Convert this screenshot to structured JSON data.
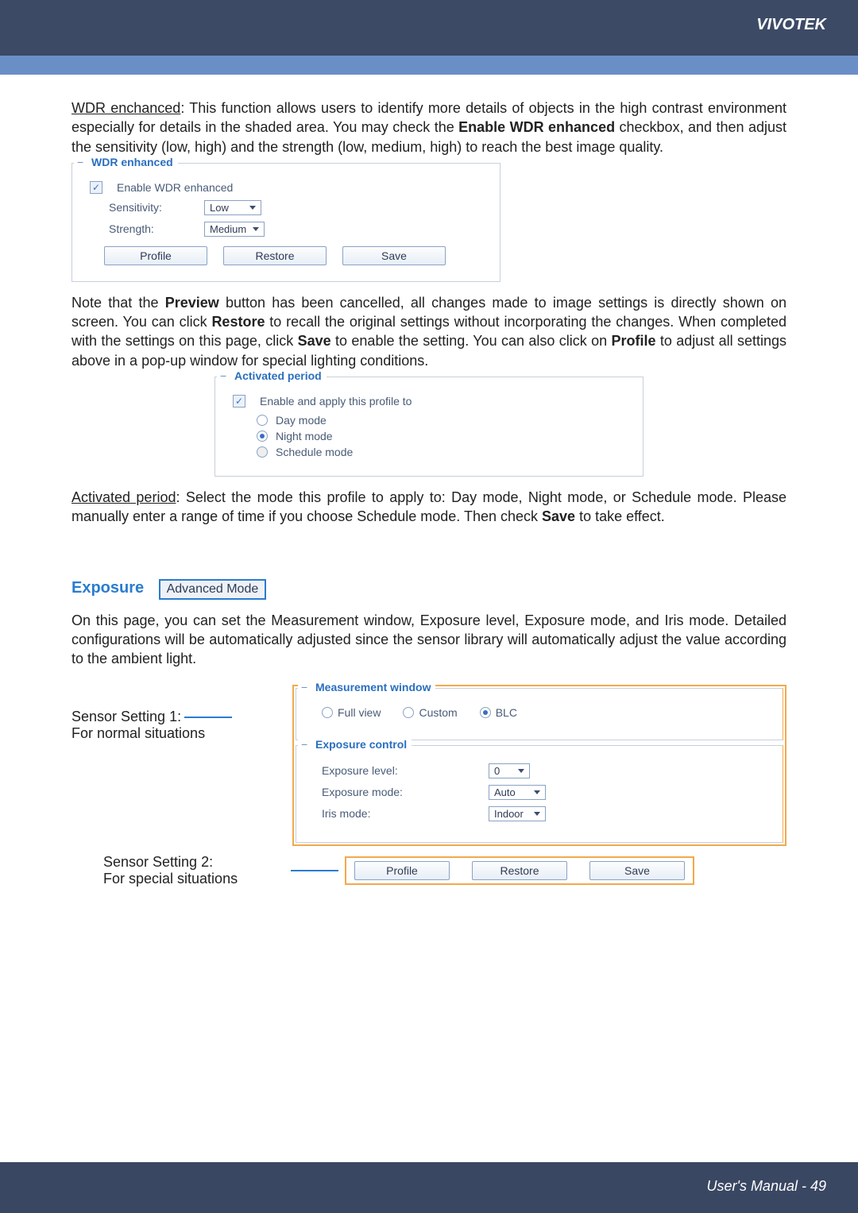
{
  "brand": "VIVOTEK",
  "para1_a": "WDR enchanced",
  "para1_b": ": This function allows users to identify more details of objects in the high contrast environment especially for details in the shaded area. You may check the ",
  "para1_c": "Enable WDR enhanced",
  "para1_d": " checkbox, and then adjust the sensitivity (low, high) and the strength (low, medium, high) to reach the best image quality.",
  "wdr": {
    "legend": "WDR enhanced",
    "enable_label": "Enable WDR enhanced",
    "sensitivity_label": "Sensitivity:",
    "sensitivity_value": "Low",
    "strength_label": "Strength:",
    "strength_value": "Medium",
    "btn_profile": "Profile",
    "btn_restore": "Restore",
    "btn_save": "Save"
  },
  "para2_a": "Note that the ",
  "para2_b": "Preview",
  "para2_c": " button has been cancelled, all changes made to image settings is directly shown on screen. You can click ",
  "para2_d": "Restore",
  "para2_e": " to recall the original settings without incorporating the changes. When completed with the settings on this page, click ",
  "para2_f": "Save",
  "para2_g": " to enable the setting. You can also click on ",
  "para2_h": "Profile",
  "para2_i": " to adjust all settings above in a pop-up window for special lighting conditions.",
  "ap": {
    "legend": "Activated period",
    "enable_label": "Enable and apply this profile to",
    "opt_day": "Day mode",
    "opt_night": "Night mode",
    "opt_schedule": "Schedule mode"
  },
  "para3_a": "Activated period",
  "para3_b": ": Select the mode this profile to apply to: Day mode, Night mode, or Schedule mode. Please manually enter a range of time if you choose Schedule mode. Then check ",
  "para3_c": "Save",
  "para3_d": " to take effect.",
  "exposure": {
    "title": "Exposure",
    "badge": "Advanced Mode",
    "para": "On this page, you can set the Measurement window, Exposure level, Exposure mode, and Iris mode. Detailed configurations will be automatically adjusted since the sensor library will automatically adjust the value according to the ambient light.",
    "sensor1_l1": "Sensor Setting 1:",
    "sensor1_l2": "For normal situations",
    "mw_legend": "Measurement window",
    "mw_full": "Full view",
    "mw_custom": "Custom",
    "mw_blc": "BLC",
    "ec_legend": "Exposure control",
    "ec_level_label": "Exposure level:",
    "ec_level_value": "0",
    "ec_mode_label": "Exposure mode:",
    "ec_mode_value": "Auto",
    "iris_label": "Iris mode:",
    "iris_value": "Indoor",
    "sensor2_l1": "Sensor Setting 2:",
    "sensor2_l2": "For special situations",
    "btn_profile": "Profile",
    "btn_restore": "Restore",
    "btn_save": "Save"
  },
  "footer": "User's Manual - 49"
}
